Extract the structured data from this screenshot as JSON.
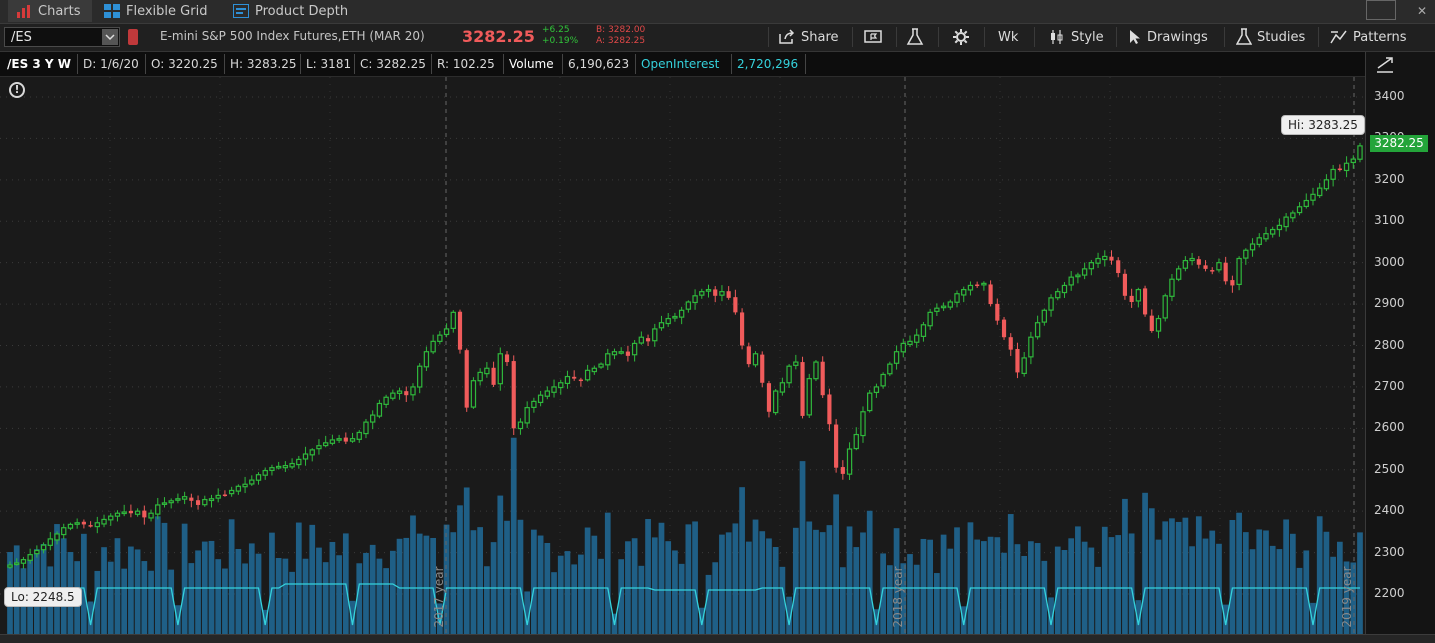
{
  "tabs": [
    {
      "label": "Charts",
      "active": true,
      "icon": "chart-bars-icon"
    },
    {
      "label": "Flexible Grid",
      "active": false,
      "icon": "grid-icon"
    },
    {
      "label": "Product Depth",
      "active": false,
      "icon": "depth-icon"
    }
  ],
  "toolbar": {
    "symbol": "/ES",
    "description": "E-mini S&P 500 Index Futures,ETH (MAR 20)",
    "last_price": "3282.25",
    "change": "+6.25",
    "change_pct": "+0.19%",
    "bid": "B: 3282.00",
    "ask": "A: 3282.25",
    "share_label": "Share",
    "period_label": "Wk",
    "style_label": "Style",
    "drawings_label": "Drawings",
    "studies_label": "Studies",
    "patterns_label": "Patterns"
  },
  "info": {
    "title": "/ES 3 Y W",
    "date": "D: 1/6/20",
    "open": "O: 3220.25",
    "high": "H: 3283.25",
    "low": "L: 3181",
    "close": "C: 3282.25",
    "range": "R: 102.25",
    "volume_label": "Volume",
    "volume_value": "6,190,623",
    "oi_label": "OpenInterest",
    "oi_value": "2,720,296"
  },
  "colors": {
    "up": "#2fb83c",
    "down": "#f05b5b",
    "volume": "#1f5f86",
    "oi": "#35d2dc",
    "background": "#1a1a1a"
  },
  "chart_data": {
    "type": "candlestick",
    "y_ticks": [
      3400,
      3300,
      3200,
      3100,
      3000,
      2900,
      2800,
      2700,
      2600,
      2500,
      2400,
      2300,
      2200
    ],
    "ylim": [
      2165,
      3490
    ],
    "year_markers": [
      "2017 year",
      "2018 year",
      "2019 year"
    ],
    "hi_label": "Hi: 3283.25",
    "lo_label": "Lo: 2248.5",
    "last_price_label": "3282.25",
    "close": [
      2270,
      2275,
      2283,
      2295,
      2305,
      2318,
      2333,
      2345,
      2360,
      2368,
      2372,
      2368,
      2365,
      2372,
      2380,
      2388,
      2395,
      2398,
      2395,
      2400,
      2385,
      2395,
      2415,
      2420,
      2425,
      2430,
      2435,
      2425,
      2415,
      2428,
      2430,
      2438,
      2440,
      2450,
      2460,
      2465,
      2475,
      2488,
      2498,
      2505,
      2508,
      2510,
      2515,
      2525,
      2538,
      2548,
      2558,
      2565,
      2572,
      2575,
      2568,
      2575,
      2590,
      2615,
      2632,
      2660,
      2675,
      2685,
      2690,
      2680,
      2700,
      2750,
      2785,
      2810,
      2825,
      2840,
      2880,
      2790,
      2650,
      2715,
      2735,
      2745,
      2705,
      2780,
      2760,
      2600,
      2615,
      2650,
      2665,
      2680,
      2690,
      2700,
      2710,
      2725,
      2720,
      2715,
      2740,
      2745,
      2755,
      2780,
      2785,
      2785,
      2775,
      2805,
      2820,
      2810,
      2840,
      2855,
      2865,
      2870,
      2885,
      2905,
      2920,
      2930,
      2935,
      2920,
      2930,
      2915,
      2880,
      2800,
      2755,
      2780,
      2710,
      2640,
      2690,
      2710,
      2750,
      2760,
      2630,
      2720,
      2760,
      2680,
      2610,
      2505,
      2490,
      2550,
      2585,
      2640,
      2685,
      2700,
      2730,
      2755,
      2785,
      2805,
      2810,
      2825,
      2850,
      2880,
      2890,
      2895,
      2905,
      2925,
      2935,
      2945,
      2945,
      2950,
      2900,
      2860,
      2820,
      2790,
      2735,
      2770,
      2820,
      2855,
      2885,
      2915,
      2930,
      2945,
      2965,
      2970,
      2985,
      3000,
      3010,
      3015,
      3005,
      2975,
      2920,
      2905,
      2935,
      2875,
      2835,
      2865,
      2920,
      2960,
      2985,
      3005,
      3010,
      2995,
      2985,
      2980,
      3000,
      2955,
      2945,
      3010,
      3030,
      3045,
      3060,
      3070,
      3080,
      3090,
      3110,
      3120,
      3135,
      3150,
      3165,
      3180,
      3200,
      3225,
      3225,
      3240,
      3250,
      3282
    ]
  }
}
